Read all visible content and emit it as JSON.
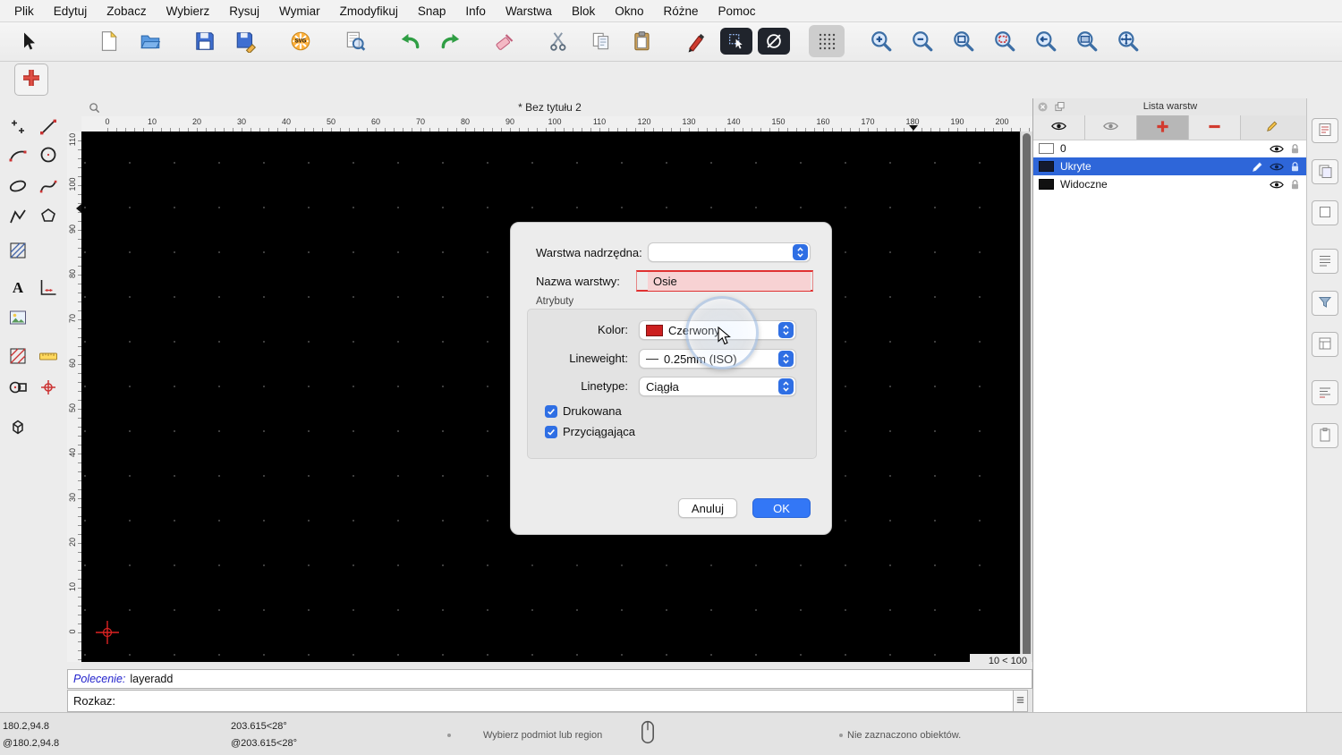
{
  "menubar": {
    "items": [
      "Plik",
      "Edytuj",
      "Zobacz",
      "Wybierz",
      "Rysuj",
      "Wymiar",
      "Zmodyfikuj",
      "Snap",
      "Info",
      "Warstwa",
      "Blok",
      "Okno",
      "Różne",
      "Pomoc"
    ]
  },
  "toolbar": {
    "icons": [
      "cursor",
      "new-file",
      "open-folder",
      "save",
      "save-as",
      "svg-export",
      "print-preview",
      "undo",
      "redo",
      "erase",
      "cut",
      "copy",
      "paste",
      "pen",
      "selection-mode",
      "draft-mode",
      "grid-toggle",
      "zoom-in",
      "zoom-out",
      "auto-zoom",
      "zoom-redraw",
      "previous-view",
      "zoom-window",
      "pan"
    ]
  },
  "action_toolbar": {
    "current_action_icon": "add-layer-red-plus"
  },
  "document": {
    "title": "* Bez tytułu 2"
  },
  "rulers": {
    "h_ticks": [
      "0",
      "10",
      "20",
      "30",
      "40",
      "50",
      "60",
      "70",
      "80",
      "90",
      "100",
      "110",
      "120",
      "130",
      "140",
      "150",
      "160",
      "170",
      "180",
      "190",
      "200"
    ],
    "v_ticks": [
      "110",
      "100",
      "90",
      "80",
      "70",
      "60",
      "50",
      "40",
      "30",
      "20",
      "10",
      "0"
    ]
  },
  "canvas": {
    "grid_info": "10 < 100"
  },
  "dialog": {
    "parent_label": "Warstwa nadrzędna:",
    "parent_value": "",
    "name_label": "Nazwa warstwy:",
    "name_value": "Osie",
    "attributes_label": "Atrybuty",
    "color_label": "Kolor:",
    "color_value": "Czerwony",
    "color_swatch_hex": "#cc1f1f",
    "lineweight_label": "Lineweight:",
    "lineweight_value": "0.25mm (ISO)",
    "linetype_label": "Linetype:",
    "linetype_value": "Ciągła",
    "print_checkbox_label": "Drukowana",
    "print_checked": true,
    "snap_checkbox_label": "Przyciągająca",
    "snap_checked": true,
    "cancel_button": "Anuluj",
    "ok_button": "OK"
  },
  "layer_panel": {
    "title": "Lista warstw",
    "layers": [
      {
        "name": "0",
        "selected": false
      },
      {
        "name": "Ukryte",
        "selected": true
      },
      {
        "name": "Widoczne",
        "selected": false
      }
    ]
  },
  "command_line": {
    "history_label": "Polecenie:",
    "history_value": "layeradd",
    "prompt_label": "Rozkaz:",
    "input_value": ""
  },
  "statusbar": {
    "abs_coord": "180.2,94.8",
    "rel_coord": "@180.2,94.8",
    "abs_polar": "203.615<28°",
    "rel_polar": "@203.615<28°",
    "hint": "Wybierz podmiot lub region",
    "selection_info": "Nie zaznaczono obiektów."
  },
  "colors": {
    "accent_blue": "#2f6fe4",
    "selection_blue": "#2e66d9",
    "layer_red": "#d23b2f",
    "canvas_black": "#000000",
    "highlight_red": "#e03131"
  }
}
